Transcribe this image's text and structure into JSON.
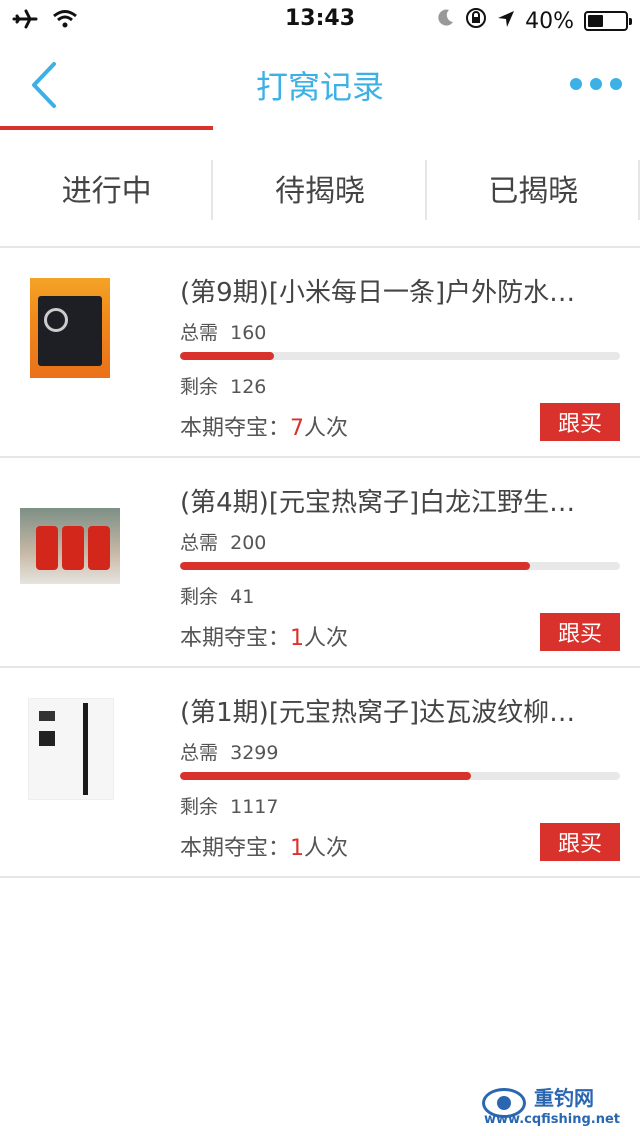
{
  "status": {
    "time": "13:43",
    "battery": "40%"
  },
  "nav": {
    "title": "打窝记录"
  },
  "tabs": [
    {
      "label": "进行中"
    },
    {
      "label": "待揭晓"
    },
    {
      "label": "已揭晓"
    }
  ],
  "items": [
    {
      "name": "(第9期)[小米每日一条]户外防水…",
      "need_label": "总需",
      "need": "160",
      "left_label": "剩余",
      "left": "126",
      "mine_label": "本期夺宝：",
      "mine_count": "7",
      "mine_unit": "人次",
      "buy": "跟买",
      "progress": 0.2125
    },
    {
      "name": "(第4期)[元宝热窝子]白龙江野生…",
      "need_label": "总需",
      "need": "200",
      "left_label": "剩余",
      "left": "41",
      "mine_label": "本期夺宝：",
      "mine_count": "1",
      "mine_unit": "人次",
      "buy": "跟买",
      "progress": 0.795
    },
    {
      "name": "(第1期)[元宝热窝子]达瓦波纹柳…",
      "need_label": "总需",
      "need": "3299",
      "left_label": "剩余",
      "left": "1117",
      "mine_label": "本期夺宝：",
      "mine_count": "1",
      "mine_unit": "人次",
      "buy": "跟买",
      "progress": 0.6614
    }
  ],
  "watermark": {
    "name": "重钓网",
    "url": "www.cqfishing.net"
  },
  "colors": {
    "accent": "#3db1e6",
    "red": "#d9322c"
  }
}
